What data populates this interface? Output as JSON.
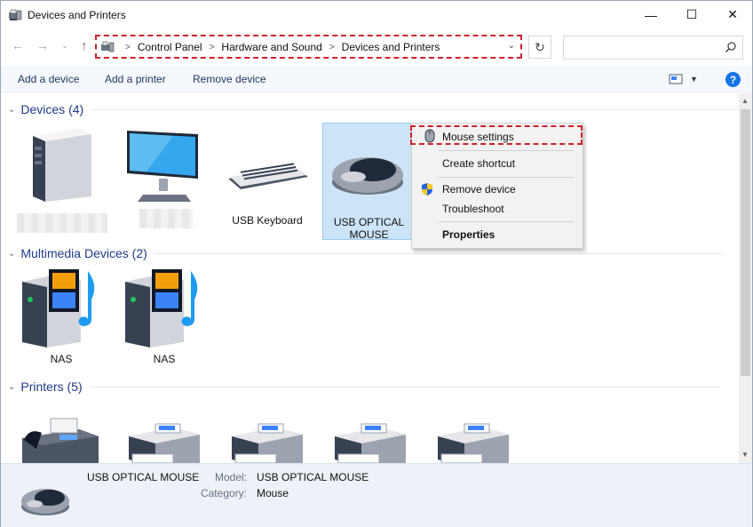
{
  "window": {
    "title": "Devices and Printers",
    "minimize_glyph": "—",
    "maximize_glyph": "☐",
    "close_glyph": "✕"
  },
  "nav": {
    "back_glyph": "←",
    "forward_glyph": "→",
    "recent_glyph": "⌄",
    "up_glyph": "↑",
    "breadcrumbs": [
      "Control Panel",
      "Hardware and Sound",
      "Devices and Printers"
    ],
    "breadcrumb_sep": ">",
    "refresh_glyph": "↻",
    "search_placeholder": ""
  },
  "toolbar": {
    "add_device": "Add a device",
    "add_printer": "Add a printer",
    "remove_device": "Remove device",
    "help_glyph": "?"
  },
  "groups": {
    "devices": {
      "title": "Devices (4)"
    },
    "multimedia": {
      "title": "Multimedia Devices (2)"
    },
    "printers": {
      "title": "Printers (5)"
    }
  },
  "devices": {
    "keyboard": "USB Keyboard",
    "mouse_line1": "USB OPTICAL",
    "mouse_line2": "MOUSE"
  },
  "multimedia": {
    "nas1": "NAS",
    "nas2": "NAS"
  },
  "context_menu": {
    "items": [
      "Mouse settings",
      "Create shortcut",
      "Remove device",
      "Troubleshoot",
      "Properties"
    ]
  },
  "details": {
    "name": "USB OPTICAL MOUSE",
    "model_label": "Model:",
    "model_value": "USB OPTICAL MOUSE",
    "category_label": "Category:",
    "category_value": "Mouse"
  },
  "colors": {
    "accent": "#1473e6",
    "group_title": "#1e3a8a",
    "selection": "#cce4f7",
    "highlight_border": "#d0202a"
  }
}
